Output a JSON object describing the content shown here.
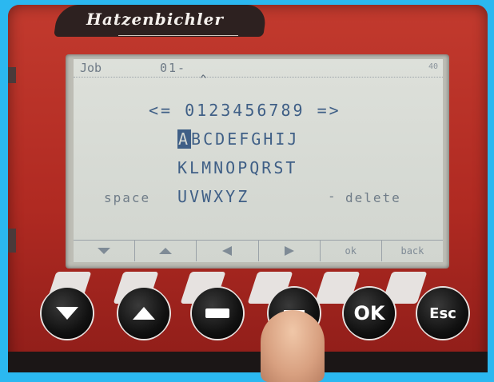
{
  "brand": {
    "name": "Hatzenbichler"
  },
  "status": {
    "job_label": "Job",
    "job_value": "01-",
    "job_index": "40"
  },
  "keyboard": {
    "nav_left": "<=",
    "digits": "0123456789",
    "nav_right": "=>",
    "row1": [
      "A",
      "B",
      "C",
      "D",
      "E",
      "F",
      "G",
      "H",
      "I",
      "J"
    ],
    "row2": "KLMNOPQRST",
    "row3": "UVWXYZ",
    "space_label": "space",
    "delete_dash": "-",
    "delete_label": "delete"
  },
  "softkeys": {
    "k1_icon": "down-arrow-icon",
    "k2_icon": "up-arrow-icon",
    "k3_icon": "left-arrow-icon",
    "k4_icon": "right-arrow-icon",
    "k5_label": "ok",
    "k6_label": "back"
  },
  "buttons": {
    "b1_icon": "down-triangle-icon",
    "b2_icon": "up-triangle-icon",
    "b3_icon": "minus-icon",
    "b4_icon": "plus-icon",
    "ok_label": "OK",
    "esc_label": "Esc"
  },
  "colors": {
    "background": "#2bb8f0",
    "device_red": "#c23a2e",
    "lcd_text": "#3f5f86",
    "lcd_bg": "#d6dad4"
  }
}
